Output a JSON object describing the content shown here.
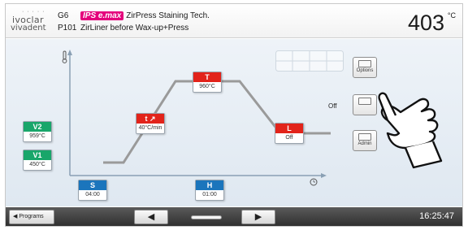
{
  "header": {
    "logo_line1": "ivoclar",
    "logo_line2": "vivadent",
    "group_code": "G6",
    "brand_tag": "IPS e.max",
    "group_name": "ZirPress Staining Tech.",
    "program_code": "P101",
    "program_name": "ZirLiner before Wax-up+Press",
    "temperature": "403",
    "temperature_unit": "°C"
  },
  "chart_data": {
    "type": "line",
    "title": "",
    "xlabel": "",
    "ylabel": "",
    "parameters": {
      "V2": "959°C",
      "V1": "450°C",
      "rate": {
        "label": "t ↗",
        "value": "40°C/min"
      },
      "T": "960°C",
      "L": "Off",
      "S": "04:00",
      "H": "01:00"
    }
  },
  "side_panel": {
    "options_label": "Options",
    "off_label": "Off",
    "admin_label": "Admin"
  },
  "footer": {
    "programs_label": "Programs",
    "back_arrow": "◀",
    "forward_arrow": "▶",
    "time": "16:25:47"
  },
  "colors": {
    "red": "#e2231a",
    "green": "#19a66a",
    "blue": "#1b75bc",
    "magenta": "#e4007c"
  },
  "icons": [
    "thermometer-icon",
    "clock-icon",
    "options-icon",
    "admin-icon",
    "hand-pointer-icon"
  ]
}
